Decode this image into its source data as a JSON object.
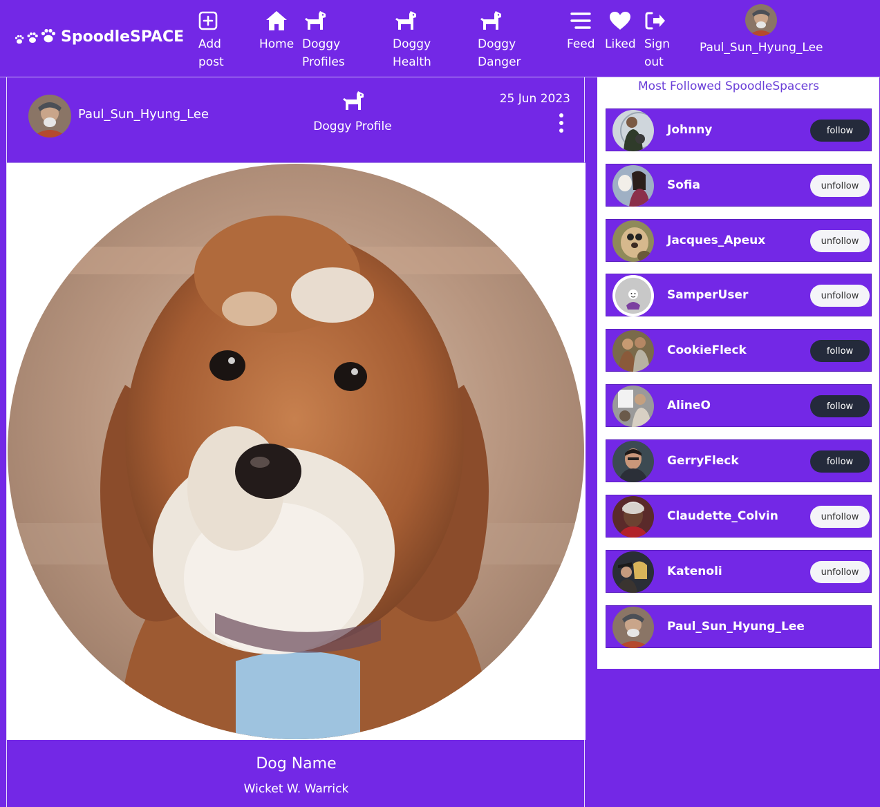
{
  "brand": {
    "name": "SpoodleSPACE"
  },
  "nav": {
    "items": [
      {
        "label_line1": "Add",
        "label_line2": "post",
        "icon": "plus-square-icon"
      },
      {
        "label_line1": "Home",
        "label_line2": "",
        "icon": "house-icon"
      },
      {
        "label_line1": "Doggy",
        "label_line2": "Profiles",
        "icon": "dog-icon"
      },
      {
        "label_line1": "Doggy",
        "label_line2": "Health",
        "icon": "dog-icon"
      },
      {
        "label_line1": "Doggy",
        "label_line2": "Danger",
        "icon": "dog-icon"
      },
      {
        "label_line1": "Feed",
        "label_line2": "",
        "icon": "menu-lines-icon"
      },
      {
        "label_line1": "Liked",
        "label_line2": "",
        "icon": "heart-icon"
      },
      {
        "label_line1": "Sign",
        "label_line2": "out",
        "icon": "sign-out-icon"
      }
    ],
    "user": {
      "name": "Paul_Sun_Hyung_Lee"
    }
  },
  "post": {
    "owner": "Paul_Sun_Hyung_Lee",
    "type_label": "Doggy Profile",
    "date": "25 Jun 2023",
    "field_label": "Dog Name",
    "field_value": "Wicket W. Warrick"
  },
  "sidebar": {
    "title": "Most Followed SpoodleSpacers",
    "profiles": [
      {
        "name": "Johnny",
        "button": "follow"
      },
      {
        "name": "Sofia",
        "button": "unfollow"
      },
      {
        "name": "Jacques_Apeux",
        "button": "unfollow"
      },
      {
        "name": "SamperUser",
        "button": "unfollow"
      },
      {
        "name": "CookieFleck",
        "button": "follow"
      },
      {
        "name": "AlineO",
        "button": "follow"
      },
      {
        "name": "GerryFleck",
        "button": "follow"
      },
      {
        "name": "Claudette_Colvin",
        "button": "unfollow"
      },
      {
        "name": "Katenoli",
        "button": "unfollow"
      },
      {
        "name": "Paul_Sun_Hyung_Lee",
        "button": ""
      }
    ]
  },
  "colors": {
    "primary": "#7328e6",
    "follow_button": "#242a3b",
    "unfollow_button": "#f4f4f8",
    "sidebar_title": "#6a3fd8"
  }
}
